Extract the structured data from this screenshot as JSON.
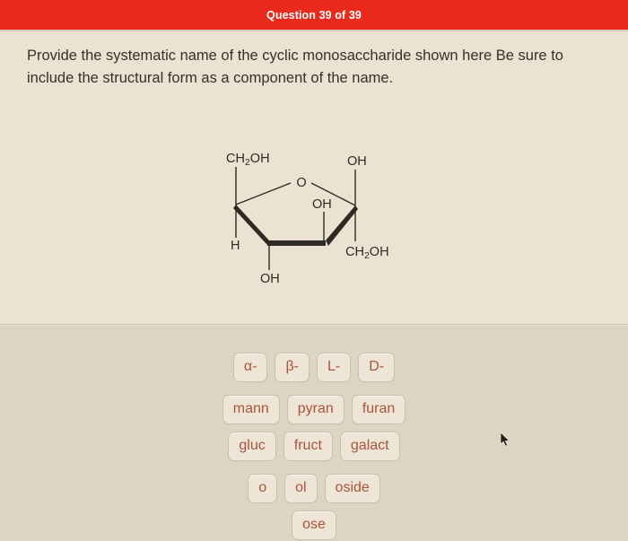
{
  "header": {
    "title": "Question 39 of 39",
    "bar_color": "#e8291c",
    "text_color": "#ffffff"
  },
  "question": {
    "text": "Provide the systematic name of the cyclic monosaccharide shown here Be sure to include the structural form as a component of the name."
  },
  "structure": {
    "description": "Haworth projection of a cyclic monosaccharide (furanose ring)",
    "ring_oxygen_label": "O",
    "labels": {
      "top_left": "CH",
      "top_left_sub": "2",
      "top_left_tail": "OH",
      "top_right": "OH",
      "interior": "OH",
      "bottom_left_substituent": "H",
      "bottom_center": "OH",
      "bottom_right": "CH",
      "bottom_right_sub": "2",
      "bottom_right_tail": "OH"
    },
    "bond_color": "#2e2a25"
  },
  "answer_field": {
    "value": "",
    "caret_visible": true
  },
  "tokens": {
    "rows": [
      [
        "α-",
        "β-",
        "L-",
        "D-"
      ],
      [
        "mann",
        "pyran",
        "furan"
      ],
      [
        "gluc",
        "fruct",
        "galact"
      ],
      [
        "o",
        "ol",
        "oside"
      ],
      [
        "ose"
      ]
    ]
  },
  "colors": {
    "page_background": "#ece2d2",
    "token_pane_background": "#ded4c2",
    "token_background": "#eee5d6",
    "token_text": "#a9543c",
    "token_border": "#c9bfae",
    "body_text": "#35302b"
  },
  "cursor": {
    "icon": "mouse-pointer-icon"
  }
}
